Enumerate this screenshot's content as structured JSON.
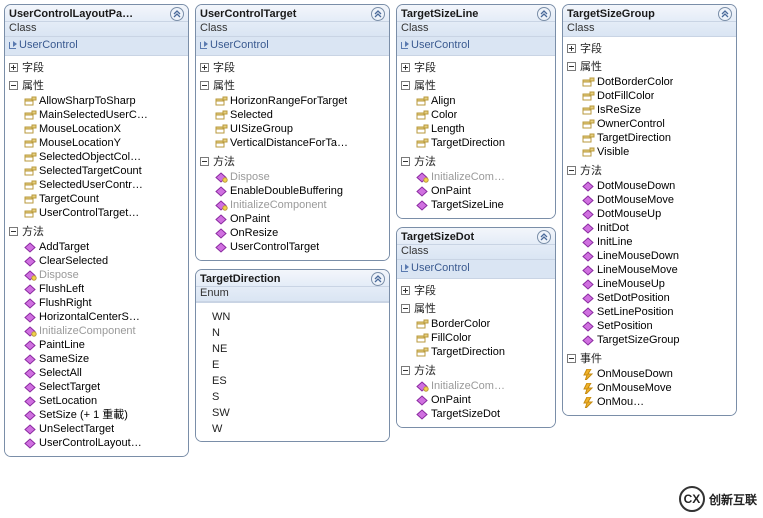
{
  "common": {
    "class_label": "Class",
    "enum_label": "Enum",
    "base_usercontrol": "UserControl",
    "section_fields": "字段",
    "section_properties": "属性",
    "section_methods": "方法",
    "section_events": "事件"
  },
  "colors": {
    "border": "#7a8ea8",
    "header_grad_top": "#f3f6fb",
    "header_grad_bottom": "#dae5f3",
    "prop_icon": "#c9b060",
    "method_icon": "#b030c0",
    "event_icon": "#e0a030"
  },
  "watermark": {
    "logo_text": "CX",
    "text": "创新互联"
  },
  "boxes": {
    "layoutPanel": {
      "title": "UserControlLayoutPa…",
      "fields_collapsed": true,
      "properties": [
        {
          "name": "AllowSharpToSharp"
        },
        {
          "name": "MainSelectedUserC…"
        },
        {
          "name": "MouseLocationX"
        },
        {
          "name": "MouseLocationY"
        },
        {
          "name": "SelectedObjectCol…"
        },
        {
          "name": "SelectedTargetCount"
        },
        {
          "name": "SelectedUserContr…"
        },
        {
          "name": "TargetCount"
        },
        {
          "name": "UserControlTarget…"
        }
      ],
      "methods": [
        {
          "name": "AddTarget"
        },
        {
          "name": "ClearSelected"
        },
        {
          "name": "Dispose",
          "gray": true
        },
        {
          "name": "FlushLeft"
        },
        {
          "name": "FlushRight"
        },
        {
          "name": "HorizontalCenterS…"
        },
        {
          "name": "InitializeComponent",
          "gray": true
        },
        {
          "name": "PaintLine"
        },
        {
          "name": "SameSize"
        },
        {
          "name": "SelectAll"
        },
        {
          "name": "SelectTarget"
        },
        {
          "name": "SetLocation"
        },
        {
          "name": "SetSize (+ 1 重載)"
        },
        {
          "name": "UnSelectTarget"
        },
        {
          "name": "UserControlLayout…"
        }
      ]
    },
    "userControlTarget": {
      "title": "UserControlTarget",
      "fields_collapsed": true,
      "properties": [
        {
          "name": "HorizonRangeForTarget"
        },
        {
          "name": "Selected"
        },
        {
          "name": "UISizeGroup"
        },
        {
          "name": "VerticalDistanceForTa…"
        }
      ],
      "methods": [
        {
          "name": "Dispose",
          "gray": true
        },
        {
          "name": "EnableDoubleBuffering"
        },
        {
          "name": "InitializeComponent",
          "gray": true
        },
        {
          "name": "OnPaint"
        },
        {
          "name": "OnResize"
        },
        {
          "name": "UserControlTarget"
        }
      ]
    },
    "targetDirection": {
      "title": "TargetDirection",
      "values": [
        "WN",
        "N",
        "NE",
        "E",
        "ES",
        "S",
        "SW",
        "W"
      ]
    },
    "targetSizeLine": {
      "title": "TargetSizeLine",
      "fields_collapsed": true,
      "properties": [
        {
          "name": "Align"
        },
        {
          "name": "Color"
        },
        {
          "name": "Length"
        },
        {
          "name": "TargetDirection"
        }
      ],
      "methods": [
        {
          "name": "InitializeCom…",
          "gray": true
        },
        {
          "name": "OnPaint"
        },
        {
          "name": "TargetSizeLine"
        }
      ]
    },
    "targetSizeDot": {
      "title": "TargetSizeDot",
      "fields_collapsed": true,
      "properties": [
        {
          "name": "BorderColor"
        },
        {
          "name": "FillColor"
        },
        {
          "name": "TargetDirection"
        }
      ],
      "methods": [
        {
          "name": "InitializeCom…",
          "gray": true
        },
        {
          "name": "OnPaint"
        },
        {
          "name": "TargetSizeDot"
        }
      ]
    },
    "targetSizeGroup": {
      "title": "TargetSizeGroup",
      "fields_collapsed": true,
      "properties": [
        {
          "name": "DotBorderColor"
        },
        {
          "name": "DotFillColor"
        },
        {
          "name": "IsReSize"
        },
        {
          "name": "OwnerControl"
        },
        {
          "name": "TargetDirection"
        },
        {
          "name": "Visible"
        }
      ],
      "methods": [
        {
          "name": "DotMouseDown"
        },
        {
          "name": "DotMouseMove"
        },
        {
          "name": "DotMouseUp"
        },
        {
          "name": "InitDot"
        },
        {
          "name": "InitLine"
        },
        {
          "name": "LineMouseDown"
        },
        {
          "name": "LineMouseMove"
        },
        {
          "name": "LineMouseUp"
        },
        {
          "name": "SetDotPosition"
        },
        {
          "name": "SetLinePosition"
        },
        {
          "name": "SetPosition"
        },
        {
          "name": "TargetSizeGroup"
        }
      ],
      "events": [
        {
          "name": "OnMouseDown"
        },
        {
          "name": "OnMouseMove"
        },
        {
          "name": "OnMou…"
        }
      ]
    }
  }
}
